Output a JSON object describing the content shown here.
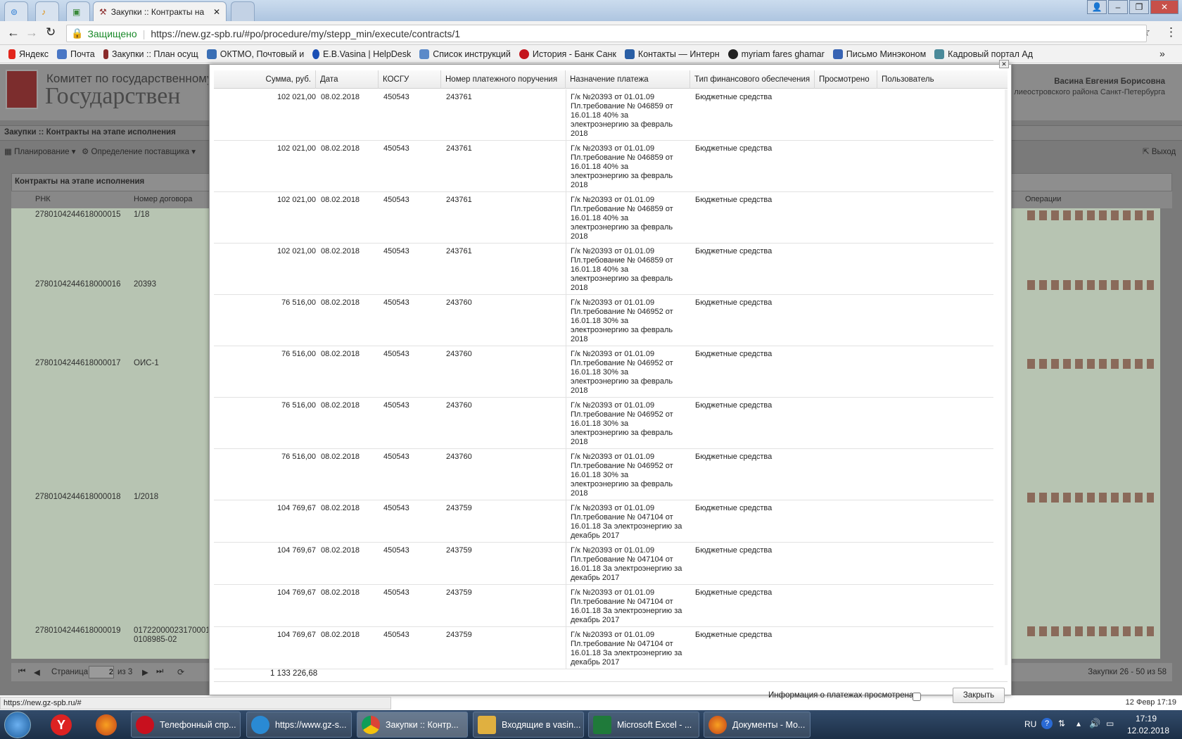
{
  "browser": {
    "tab_title": "Закупки :: Контракты на",
    "secure_label": "Защищено",
    "url": "https://new.gz-spb.ru/#po/procedure/my/stepp_min/execute/contracts/1",
    "bookmarks": [
      "Яндекс",
      "Почта",
      "Закупки :: План осущ",
      "ОКТМО, Почтовый и",
      "E.B.Vasina | HelpDesk",
      "Список инструкций",
      "История - Банк Санк",
      "Контакты — Интерн",
      "myriam fares ghamar",
      "Письмо Минэконом",
      "Кадровый портал Ад"
    ],
    "more": "»"
  },
  "app": {
    "logo_line1": "Комитет по государственному заказ",
    "logo_line2": "Государствен",
    "user_name": "Васина Евгения Борисовна",
    "user_org": "лиеостровского района Санкт-Петербурга",
    "breadcrumb": "Закупки :: Контракты на этапе исполнения",
    "menu_planning": "Планирование",
    "menu_supplier": "Определение поставщика",
    "exit": "Выход",
    "panel_title": "Контракты на этапе исполнения",
    "col_rnk": "РНК",
    "col_number": "Номер договора",
    "col_ops": "Операции",
    "rows": [
      {
        "rnk": "2780104244618000015",
        "num": "1/18"
      },
      {
        "rnk": "2780104244618000016",
        "num": "20393"
      },
      {
        "rnk": "2780104244618000017",
        "num": "ОИС-1"
      },
      {
        "rnk": "2780104244618000018",
        "num": "1/2018"
      },
      {
        "rnk": "2780104244618000019",
        "num": "01722000023170001",
        "num2": "0108985-02"
      }
    ],
    "pager_page": "Страница",
    "pager_value": "2",
    "pager_of": "из 3",
    "pager_info": "Закупки 26 - 50 из 58",
    "date_right": "12 Февр 17:19"
  },
  "modal": {
    "headers": [
      "Сумма, руб.",
      "Дата",
      "КОСГУ",
      "Номер платежного поручения",
      "Назначение платежа",
      "Тип финансового обеспечения",
      "Просмотрено",
      "Пользователь"
    ],
    "rows": [
      {
        "sum": "102 021,00",
        "date": "08.02.2018",
        "kosgu": "450543",
        "pp": "243761",
        "purpose": [
          "Г/к №20393 от 01.01.09",
          "Пл.требование № 046859 от",
          "16.01.18 40% за",
          "электроэнергию за февраль",
          "2018"
        ],
        "fin": "Бюджетные средства"
      },
      {
        "sum": "102 021,00",
        "date": "08.02.2018",
        "kosgu": "450543",
        "pp": "243761",
        "purpose": [
          "Г/к №20393 от 01.01.09",
          "Пл.требование № 046859 от",
          "16.01.18 40% за",
          "электроэнергию за февраль",
          "2018"
        ],
        "fin": "Бюджетные средства"
      },
      {
        "sum": "102 021,00",
        "date": "08.02.2018",
        "kosgu": "450543",
        "pp": "243761",
        "purpose": [
          "Г/к №20393 от 01.01.09",
          "Пл.требование № 046859 от",
          "16.01.18 40% за",
          "электроэнергию за февраль",
          "2018"
        ],
        "fin": "Бюджетные средства"
      },
      {
        "sum": "102 021,00",
        "date": "08.02.2018",
        "kosgu": "450543",
        "pp": "243761",
        "purpose": [
          "Г/к №20393 от 01.01.09",
          "Пл.требование № 046859 от",
          "16.01.18 40% за",
          "электроэнергию за февраль",
          "2018"
        ],
        "fin": "Бюджетные средства"
      },
      {
        "sum": "76 516,00",
        "date": "08.02.2018",
        "kosgu": "450543",
        "pp": "243760",
        "purpose": [
          "Г/к №20393 от 01.01.09",
          "Пл.требование № 046952 от",
          "16.01.18 30% за",
          "электроэнергию за февраль",
          "2018"
        ],
        "fin": "Бюджетные средства"
      },
      {
        "sum": "76 516,00",
        "date": "08.02.2018",
        "kosgu": "450543",
        "pp": "243760",
        "purpose": [
          "Г/к №20393 от 01.01.09",
          "Пл.требование № 046952 от",
          "16.01.18 30% за",
          "электроэнергию за февраль",
          "2018"
        ],
        "fin": "Бюджетные средства"
      },
      {
        "sum": "76 516,00",
        "date": "08.02.2018",
        "kosgu": "450543",
        "pp": "243760",
        "purpose": [
          "Г/к №20393 от 01.01.09",
          "Пл.требование № 046952 от",
          "16.01.18 30% за",
          "электроэнергию за февраль",
          "2018"
        ],
        "fin": "Бюджетные средства"
      },
      {
        "sum": "76 516,00",
        "date": "08.02.2018",
        "kosgu": "450543",
        "pp": "243760",
        "purpose": [
          "Г/к №20393 от 01.01.09",
          "Пл.требование № 046952 от",
          "16.01.18 30% за",
          "электроэнергию за февраль",
          "2018"
        ],
        "fin": "Бюджетные средства"
      },
      {
        "sum": "104 769,67",
        "date": "08.02.2018",
        "kosgu": "450543",
        "pp": "243759",
        "purpose": [
          "Г/к №20393 от 01.01.09",
          "Пл.требование № 047104 от",
          "16.01.18 За электроэнергию за",
          "декабрь 2017"
        ],
        "fin": "Бюджетные средства"
      },
      {
        "sum": "104 769,67",
        "date": "08.02.2018",
        "kosgu": "450543",
        "pp": "243759",
        "purpose": [
          "Г/к №20393 от 01.01.09",
          "Пл.требование № 047104 от",
          "16.01.18 За электроэнергию за",
          "декабрь 2017"
        ],
        "fin": "Бюджетные средства"
      },
      {
        "sum": "104 769,67",
        "date": "08.02.2018",
        "kosgu": "450543",
        "pp": "243759",
        "purpose": [
          "Г/к №20393 от 01.01.09",
          "Пл.требование № 047104 от",
          "16.01.18 За электроэнергию за",
          "декабрь 2017"
        ],
        "fin": "Бюджетные средства"
      },
      {
        "sum": "104 769,67",
        "date": "08.02.2018",
        "kosgu": "450543",
        "pp": "243759",
        "purpose": [
          "Г/к №20393 от 01.01.09",
          "Пл.требование № 047104 от",
          "16.01.18 За электроэнергию за",
          "декабрь 2017"
        ],
        "fin": "Бюджетные средства"
      }
    ],
    "total": "1 133 226,68",
    "viewed_label": "Информация о платежах просмотрена",
    "close_label": "Закрыть"
  },
  "statusbar": "https://new.gz-spb.ru/#",
  "taskbar": {
    "items": [
      "Телефонный спр...",
      "https://www.gz-s...",
      "Закупки :: Контр...",
      "Входящие в vasin...",
      "Microsoft Excel - ...",
      "Документы - Mo..."
    ],
    "lang": "RU",
    "time": "17:19",
    "date": "12.02.2018"
  },
  "colors": {
    "accent_green": "#b7c4b2",
    "modal_bg": "#ffffff",
    "taskbar": "#1c2f47"
  }
}
